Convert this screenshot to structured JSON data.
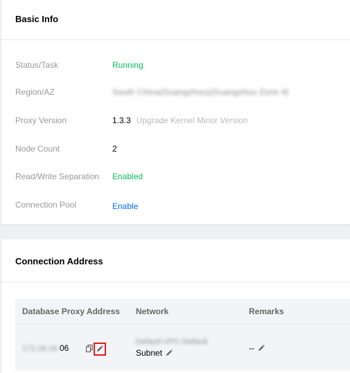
{
  "basic_info": {
    "title": "Basic Info",
    "rows": [
      {
        "label": "Status/Task",
        "value": "Running"
      },
      {
        "label": "Region/AZ",
        "value": "South China(Guangzhou)(Guangzhou Zone 4)"
      },
      {
        "label": "Proxy Version",
        "value": "1.3.3",
        "hint": "Upgrade Kernel Minor Version"
      },
      {
        "label": "Node Count",
        "value": "2"
      },
      {
        "label": "Read/Write Separation",
        "value": "Enabled"
      },
      {
        "label": "Connection Pool",
        "value": "Enable"
      }
    ]
  },
  "connection_address": {
    "title": "Connection Address",
    "columns": [
      "Database Proxy Address",
      "Network",
      "Remarks"
    ],
    "row": {
      "address_blurred": "172.16.16.",
      "address_suffix": "06",
      "network_blurred": "Default-VPC-Default",
      "subnet_label": "Subnet",
      "remarks": "--"
    }
  },
  "icons": {
    "copy": "copy-icon",
    "edit": "pencil-icon"
  },
  "colors": {
    "running": "#0abf5b",
    "enabled": "#0abf5b",
    "link": "#006eff",
    "highlight_box": "#e21b1b"
  }
}
